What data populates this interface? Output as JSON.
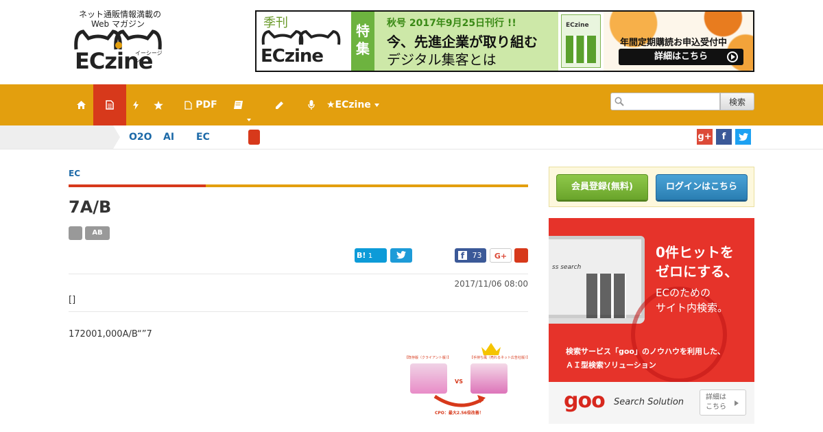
{
  "logo": {
    "tagline_1": "ネット通販情報満載の",
    "tagline_2": "Web マガジン",
    "wordmark": "ECzine",
    "sub": "イーシージン"
  },
  "banner": {
    "season": "季刊",
    "wordmark": "ECzine",
    "feature": "特集",
    "issue": "秋号 2017年9月25日刊行 !!",
    "headline_1": "今、先進企業が取り組む",
    "headline_2": "デジタル集客とは",
    "magazine": "ECzine",
    "subscribe": "年間定期購読お申込受付中",
    "cta": "詳細はこちら"
  },
  "nav": {
    "items": [
      {
        "label": "",
        "icon": "home-icon"
      },
      {
        "label": "",
        "icon": "document-icon"
      },
      {
        "label": "",
        "icon": "lightning-icon"
      },
      {
        "label": "",
        "icon": "star-icon"
      },
      {
        "label": "PDF",
        "icon": "pdf-icon"
      },
      {
        "label": "",
        "icon": "book-icon"
      },
      {
        "label": "",
        "icon": "pencil-icon"
      },
      {
        "label": "",
        "icon": "microphone-icon"
      },
      {
        "label": "★ECzine",
        "icon": "caret-down-icon"
      }
    ],
    "search_placeholder": "",
    "search_button": "検索"
  },
  "subnav": {
    "links": [
      "O2O",
      "AI",
      "EC"
    ]
  },
  "article": {
    "category": "EC",
    "title": "7A/B",
    "tags": [
      "",
      "AB"
    ],
    "hatena_label": "B!",
    "hatena_count": "1",
    "facebook_count": "73",
    "gplus_label": "G+",
    "date": "2017/11/06 08:00",
    "lead": "[]",
    "body": "172001,000A/B“”7",
    "figure": {
      "label_left": "【既存版（クライアント版）】",
      "label_right": "【手持ち風（売れるネット広告社版）】",
      "vs": "VS",
      "caption": "CPO：最大2.56倍改善！"
    }
  },
  "sidebar": {
    "register_button": "会員登録(無料)",
    "login_button": "ログインはこちら",
    "ad": {
      "headline_1": "0件ヒットを",
      "headline_2": "ゼロにする、",
      "headline_3": "ECのための",
      "headline_4": "サイト内検索。",
      "desc_1": "検索サービス「goo」のノウハウを利用した、",
      "desc_2": "ＡＩ型検索ソリューション",
      "brand": "goo",
      "brand_sub": "Search Solution",
      "more_1": "詳細は",
      "more_2": "こちら",
      "screen_text": "ss search"
    }
  },
  "colors": {
    "nav_bg": "#e39f0e",
    "accent_red": "#d7391b",
    "link_blue": "#1d6aa8",
    "ad_red": "#e6332a"
  }
}
